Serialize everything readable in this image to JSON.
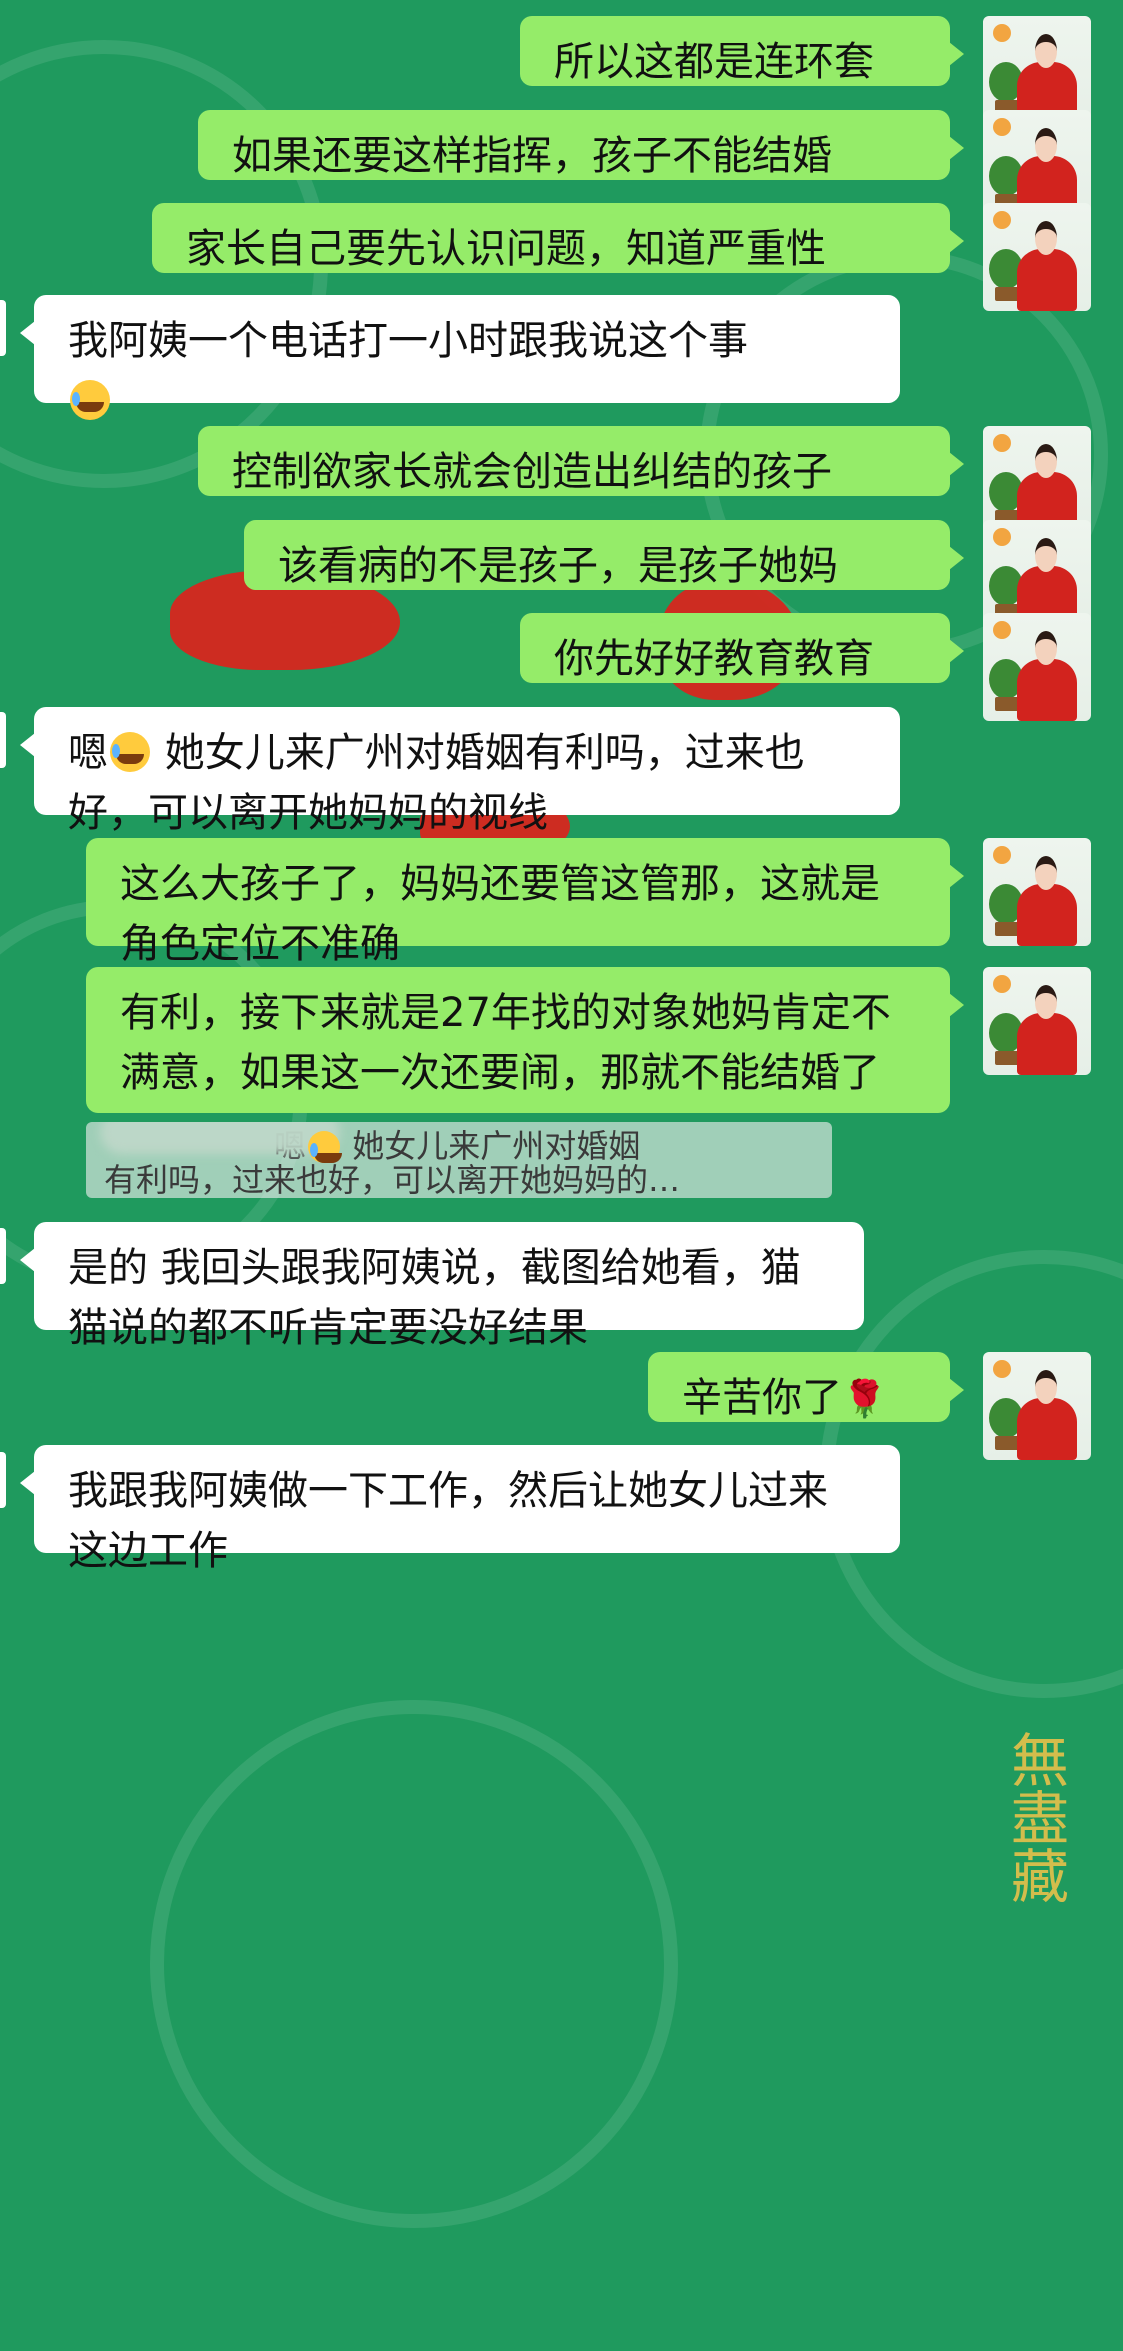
{
  "messages": [
    {
      "side": "me",
      "text": "所以这都是连环套"
    },
    {
      "side": "me",
      "text": "如果还要这样指挥，孩子不能结婚"
    },
    {
      "side": "me",
      "text": "家长自己要先认识问题，知道严重性"
    },
    {
      "side": "them",
      "text": "我阿姨一个电话打一小时跟我说这个事",
      "emoji": "face-with-tears-icon"
    },
    {
      "side": "me",
      "text": "控制欲家长就会创造出纠结的孩子"
    },
    {
      "side": "me",
      "text": "该看病的不是孩子，是孩子她妈"
    },
    {
      "side": "me",
      "text": "你先好好教育教育"
    },
    {
      "side": "them",
      "text_a": "嗯",
      "text_b": " 她女儿来广州对婚姻有利吗，过来也好，可以离开她妈妈的视线"
    },
    {
      "side": "me",
      "text": "这么大孩子了，妈妈还要管这管那，这就是角色定位不准确"
    },
    {
      "side": "me",
      "text": "有利，接下来就是27年找的对象她妈肯定不满意，如果这一次还要闹，那就不能结婚了"
    },
    {
      "side": "them",
      "text": "是的 我回头跟我阿姨说，截图给她看，猫猫说的都不听肯定要没好结果"
    },
    {
      "side": "me",
      "text": "辛苦你了"
    },
    {
      "side": "them",
      "text": "我跟我阿姨做一下工作，然后让她女儿过来这边工作"
    }
  ],
  "quote": {
    "line1": "嗯",
    "line1b": " 她女儿来广州对婚姻",
    "line2": "有利吗，过来也好，可以离开她妈妈的…"
  },
  "wallpaper_text": "無盡藏",
  "colors": {
    "my_bubble": "#95ec69",
    "their_bubble": "#ffffff",
    "background": "#1f9a5e"
  }
}
